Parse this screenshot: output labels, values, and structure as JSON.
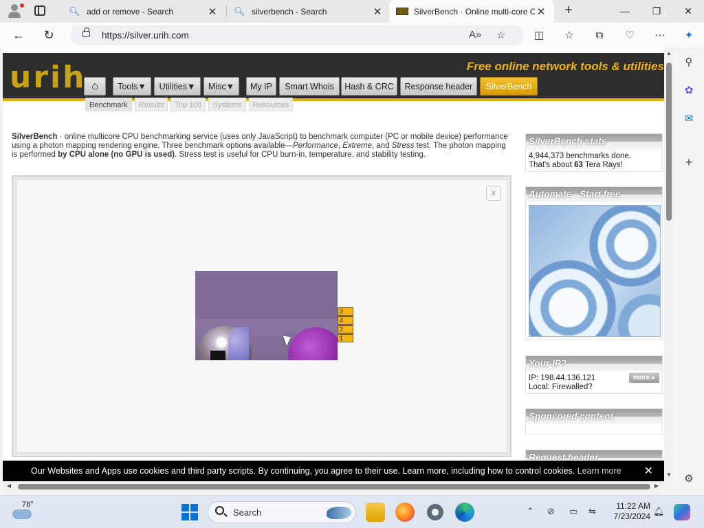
{
  "browser": {
    "tabs": [
      {
        "title": "add or remove - Search",
        "icon": "search-icon"
      },
      {
        "title": "silverbench - Search",
        "icon": "search-icon"
      },
      {
        "title": "SilverBench · Online multi-core C",
        "icon": "site-favicon"
      }
    ],
    "url": "https://silver.urih.com"
  },
  "site": {
    "logo": "urih",
    "tagline": "Free online  network tools & utilities",
    "nav": [
      "Tools▼",
      "Utilities▼",
      "Misc▼",
      "My IP",
      "Smart Whois",
      "Hash & CRC",
      "Response header",
      "SilverBench"
    ],
    "subnav": [
      "Benchmark",
      "Results",
      "Top 100",
      "Systems",
      "Resources"
    ],
    "intro": {
      "name": "SilverBench",
      "p1": " · online multicore CPU benchmarking service (uses only JavaScript) to benchmark computer (PC or mobile device) performance using a photon mapping rendering engine. Three benchmark options available—",
      "opt1": "Performance",
      "sep1": ", ",
      "opt2": "Extreme",
      "sep2": ", and ",
      "opt3": "Stress",
      "p2": " test. The photon mapping is performed ",
      "bold": "by CPU alone (no GPU is used)",
      "p3": ". Stress test is useful for CPU burn-in, temperature, and stability testing."
    },
    "bench": {
      "close": "x",
      "lanes": [
        "3",
        "4",
        "2",
        "1"
      ]
    },
    "sidebar": {
      "stats_title": "SilverBench stats",
      "stats_line1": "4,944,373 benchmarks done.",
      "stats_line2a": "That's about ",
      "stats_rays": "63",
      "stats_line2b": " Tera Rays!",
      "automate_title": "Automate · Start free",
      "ip_title": "Your IP?",
      "ip_line": "IP: 198.44.136.121",
      "local_line": "Local: Firewalled?",
      "more": "more ▸",
      "sponsored_title": "Sponsored content",
      "request_title": "Request header"
    },
    "cookie": {
      "text": "Our Websites and Apps use cookies and third party scripts. By continuing, you agree to their use. Learn more, including how to control cookies.",
      "link": "Learn more",
      "close": "✕"
    }
  },
  "taskbar": {
    "temp": "78°",
    "search": "Search",
    "time": "11:22 AM",
    "date": "7/23/2024"
  },
  "colors": {
    "accent": "#e7b10d",
    "header_bg": "#2d2d2d",
    "tagline": "#f0b414"
  }
}
